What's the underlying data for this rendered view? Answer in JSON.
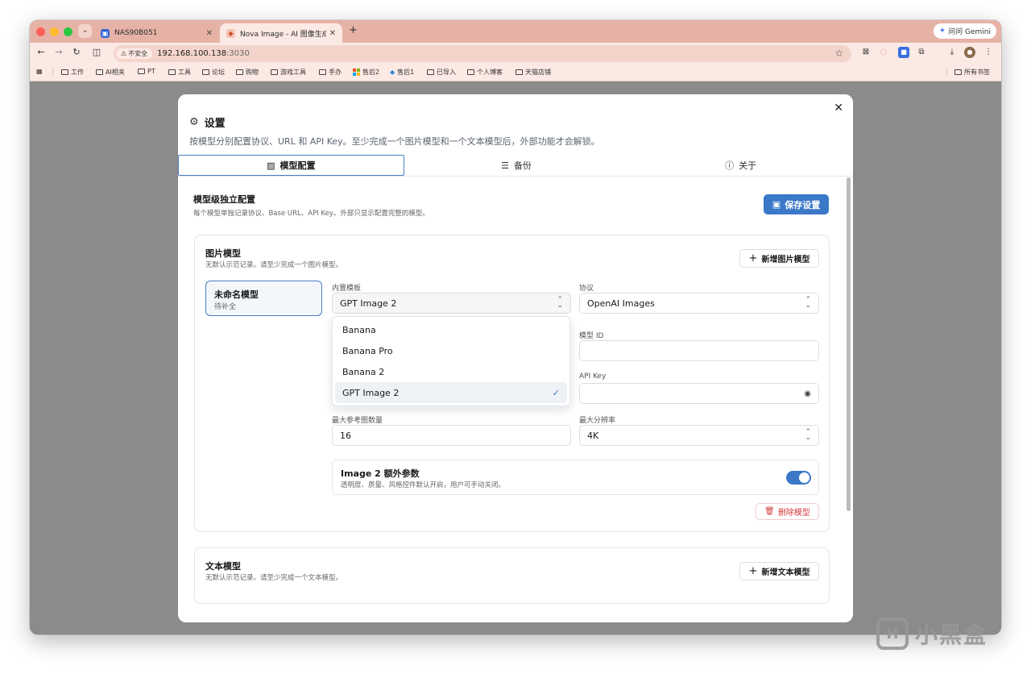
{
  "browser": {
    "tabs": [
      {
        "title": "NAS90B051",
        "active": false
      },
      {
        "title": "Nova Image - AI 图像生成器",
        "active": true
      }
    ],
    "gemini_label": "问问 Gemini",
    "url": {
      "insecure_label": "不安全",
      "host": "192.168.100.138",
      "port": ":3030"
    },
    "bookmarks": [
      "工作",
      "AI相关",
      "PT",
      "工具",
      "论坛",
      "购物",
      "游戏工具",
      "手办",
      "售后2",
      "售后1",
      "已导入",
      "个人博客",
      "天猫店铺"
    ],
    "all_bookmarks_label": "所有书签"
  },
  "modal": {
    "title": "设置",
    "description": "按模型分别配置协议、URL 和 API Key。至少完成一个图片模型和一个文本模型后，外部功能才会解锁。",
    "tabs": [
      {
        "label": "模型配置",
        "icon": "image-icon",
        "active": true
      },
      {
        "label": "备份",
        "icon": "database-icon",
        "active": false
      },
      {
        "label": "关于",
        "icon": "info-icon",
        "active": false
      }
    ],
    "section": {
      "title": "模型级独立配置",
      "subtitle": "每个模型单独记录协议、Base URL、API Key。外部只显示配置完整的模型。",
      "save_label": "保存设置"
    },
    "image_models": {
      "title": "图片模型",
      "subtitle": "无默认示范记录。请至少完成一个图片模型。",
      "add_label": "新增图片模型",
      "model": {
        "name": "未命名模型",
        "status": "待补全"
      },
      "template_label": "内置模板",
      "template_value": "GPT Image 2",
      "template_options": [
        "Banana",
        "Banana Pro",
        "Banana 2",
        "GPT Image 2"
      ],
      "protocol_label": "协议",
      "protocol_value": "OpenAI Images",
      "model_id_label": "模型 ID",
      "model_id_value": "",
      "api_key_label": "API Key",
      "api_key_value": "",
      "max_ref_label": "最大参考图数量",
      "max_ref_value": "16",
      "max_res_label": "最大分辨率",
      "max_res_value": "4K",
      "extra": {
        "title": "Image 2 额外参数",
        "subtitle": "透明度、质量、风格控件默认开启，用户可手动关闭。",
        "enabled": true
      },
      "delete_label": "删除模型"
    },
    "text_models": {
      "title": "文本模型",
      "subtitle": "无默认示范记录。请至少完成一个文本模型。",
      "add_label": "新增文本模型"
    }
  },
  "watermark": {
    "text": "小黑盒"
  },
  "colors": {
    "accent": "#3b78c8",
    "danger": "#d33a3a",
    "tabstrip": "#e7b2a6"
  }
}
